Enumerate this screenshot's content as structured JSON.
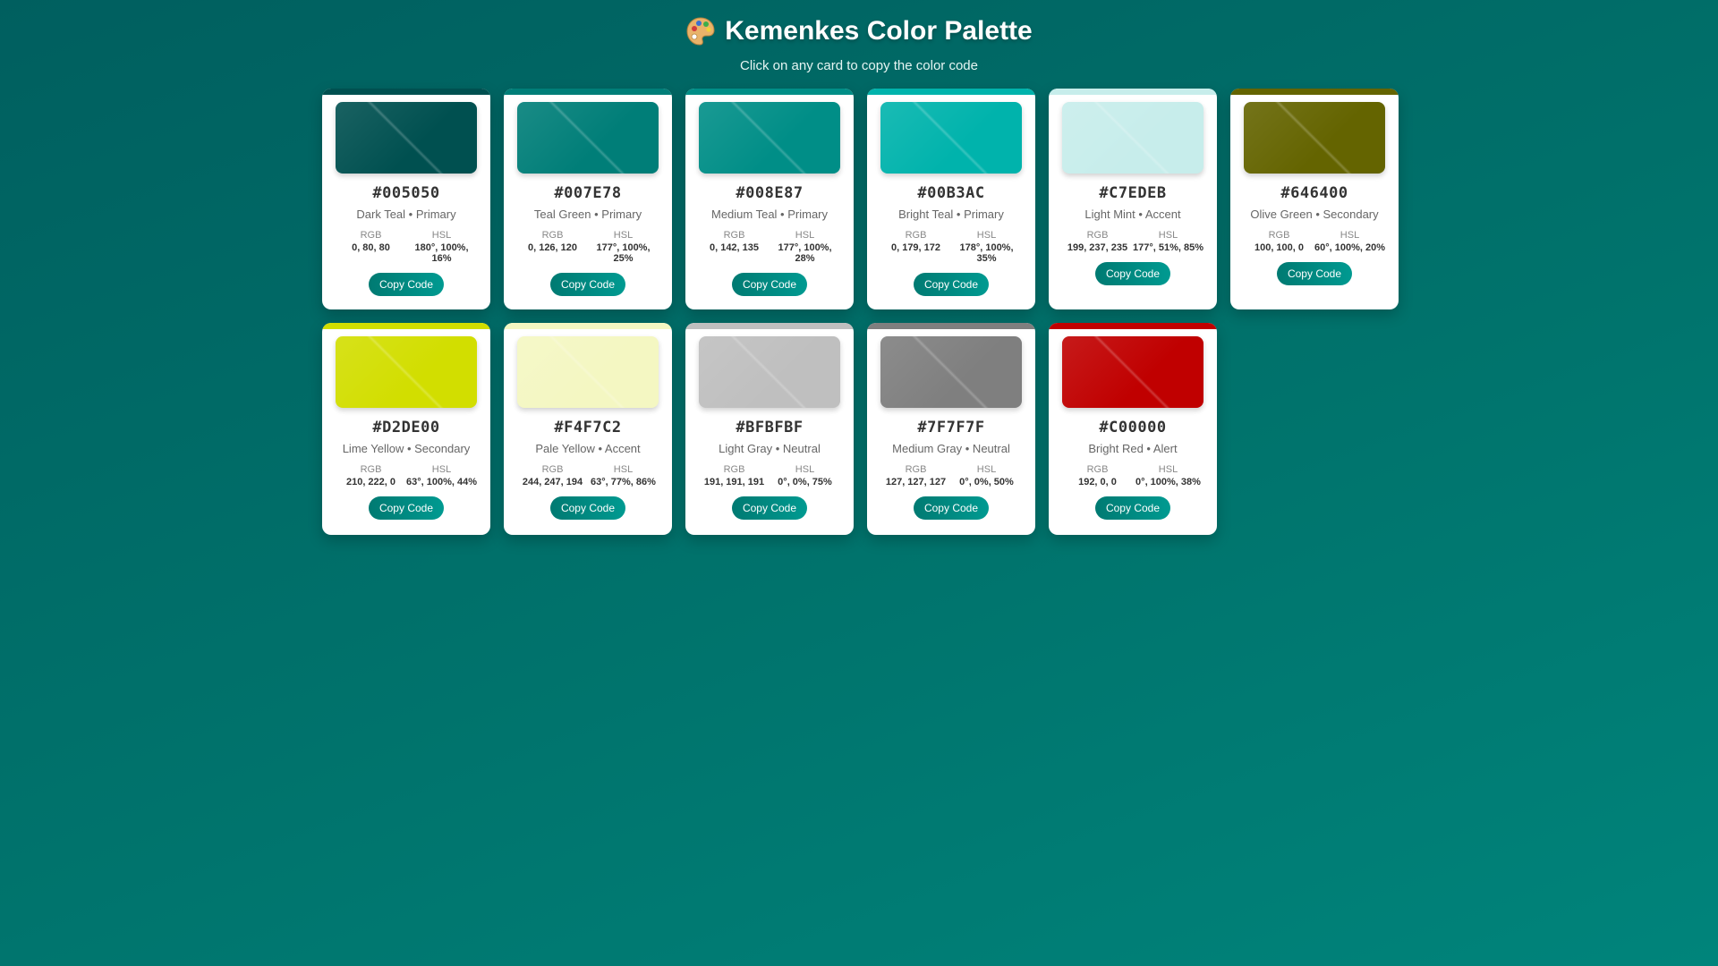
{
  "header": {
    "title": "Kemenkes Color Palette",
    "subtitle": "Click on any card to copy the color code"
  },
  "labels": {
    "rgb": "RGB",
    "hsl": "HSL",
    "copy": "Copy Code"
  },
  "colors": [
    {
      "hex": "#005050",
      "name": "Dark Teal • Primary",
      "rgb": "0, 80, 80",
      "hsl": "180°, 100%, 16%"
    },
    {
      "hex": "#007E78",
      "name": "Teal Green • Primary",
      "rgb": "0, 126, 120",
      "hsl": "177°, 100%, 25%"
    },
    {
      "hex": "#008E87",
      "name": "Medium Teal • Primary",
      "rgb": "0, 142, 135",
      "hsl": "177°, 100%, 28%"
    },
    {
      "hex": "#00B3AC",
      "name": "Bright Teal • Primary",
      "rgb": "0, 179, 172",
      "hsl": "178°, 100%, 35%"
    },
    {
      "hex": "#C7EDEB",
      "name": "Light Mint • Accent",
      "rgb": "199, 237, 235",
      "hsl": "177°, 51%, 85%"
    },
    {
      "hex": "#646400",
      "name": "Olive Green • Secondary",
      "rgb": "100, 100, 0",
      "hsl": "60°, 100%, 20%"
    },
    {
      "hex": "#D2DE00",
      "name": "Lime Yellow • Secondary",
      "rgb": "210, 222, 0",
      "hsl": "63°, 100%, 44%"
    },
    {
      "hex": "#F4F7C2",
      "name": "Pale Yellow • Accent",
      "rgb": "244, 247, 194",
      "hsl": "63°, 77%, 86%"
    },
    {
      "hex": "#BFBFBF",
      "name": "Light Gray • Neutral",
      "rgb": "191, 191, 191",
      "hsl": "0°, 0%, 75%"
    },
    {
      "hex": "#7F7F7F",
      "name": "Medium Gray • Neutral",
      "rgb": "127, 127, 127",
      "hsl": "0°, 0%, 50%"
    },
    {
      "hex": "#C00000",
      "name": "Bright Red • Alert",
      "rgb": "192, 0, 0",
      "hsl": "0°, 100%, 38%"
    }
  ]
}
